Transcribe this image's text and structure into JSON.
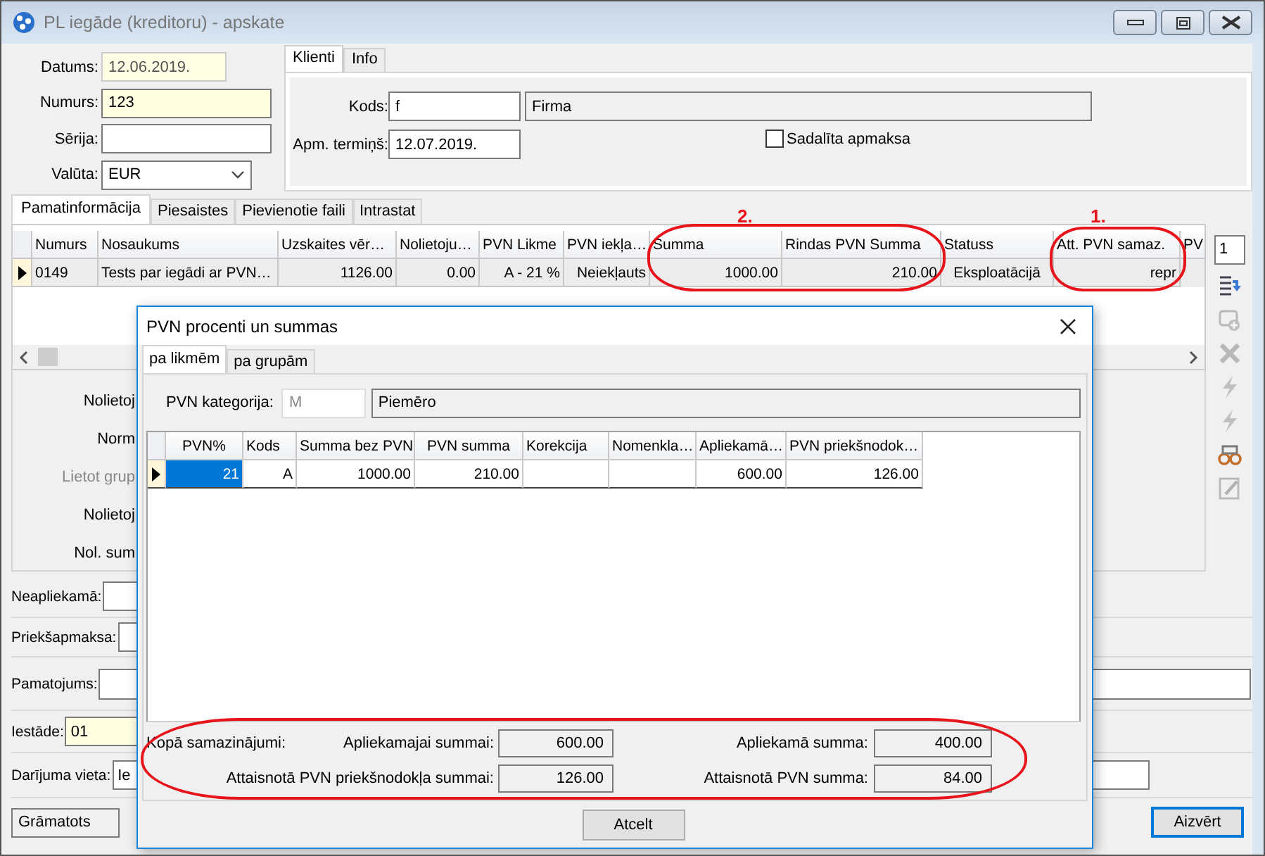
{
  "window": {
    "title": "PL iegāde (kreditoru) - apskate"
  },
  "header_fields": [
    {
      "label": "Datums:",
      "value": "12.06.2019.",
      "kind": "readonly"
    },
    {
      "label": "Numurs:",
      "value": "123",
      "kind": "required"
    },
    {
      "label": "Sērija:",
      "kind": "text"
    },
    {
      "label": "Valūta:",
      "value": "EUR",
      "kind": "dropdown"
    }
  ],
  "client_tabs": [
    {
      "label": "Klienti",
      "selected": true
    },
    {
      "label": "Info",
      "selected": false
    }
  ],
  "client": {
    "code_label": "Kods:",
    "code": "f",
    "name": "Firma",
    "due_label": "Apm. termiņš:",
    "due": "12.07.2019.",
    "split_payment": {
      "label": "Sadalīta apmaksa",
      "checked": false
    }
  },
  "main_tabs": [
    {
      "label": "Pamatinformācija",
      "selected": true
    },
    {
      "label": "Piesaistes",
      "selected": false
    },
    {
      "label": "Pievienotie faili",
      "selected": false
    },
    {
      "label": "Intrastat",
      "selected": false
    }
  ],
  "assets_table": {
    "columns": [
      "Numurs",
      "Nosaukums",
      "Uzskaites vēr…",
      "Nolietoju…",
      "PVN Likme",
      "PVN iekļa…",
      "Summa",
      "Rindas PVN Summa",
      "Statuss",
      "Att. PVN samaz.",
      "PV"
    ],
    "rows": [
      {
        "selected": true,
        "cells": [
          "0149",
          "Tests par iegādi ar PVN…",
          "1126.00",
          "0.00",
          "A - 21 %",
          "Neiekļauts",
          "1000.00",
          "210.00",
          "Eksploatācijā",
          "repr"
        ]
      }
    ]
  },
  "toolbar": {
    "page": "1",
    "buttons": [
      {
        "kind": "list",
        "disabled": false
      },
      {
        "kind": "add",
        "disabled": true
      },
      {
        "kind": "delete",
        "disabled": true
      },
      {
        "kind": "flash",
        "disabled": true
      },
      {
        "kind": "flash",
        "disabled": true
      },
      {
        "kind": "link",
        "disabled": false
      },
      {
        "kind": "edit",
        "disabled": true
      }
    ]
  },
  "details": [
    {
      "label": "Nolietoj",
      "disabled": false
    },
    {
      "label": "Norm",
      "disabled": false
    },
    {
      "label": "Lietot grup",
      "disabled": true
    },
    {
      "label": "Nolietoj",
      "disabled": false
    },
    {
      "label": "Nol. sum",
      "disabled": false
    }
  ],
  "bottom_fields": [
    {
      "label": "Neapliekamā:",
      "kind": "text"
    },
    {
      "label": "Priekšapmaksa:",
      "kind": "text"
    },
    {
      "label": "Pamatojums:",
      "kind": "memo"
    },
    {
      "label": "Iestāde:",
      "value": "01",
      "kind": "required"
    },
    {
      "label": "Darījuma vieta:",
      "value": "Ie",
      "kind": "text"
    }
  ],
  "status": "Grāmatots",
  "close_button": "Aizvērt",
  "dialog": {
    "title": "PVN procenti un summas",
    "tabs": [
      {
        "label": "pa likmēm",
        "selected": true
      },
      {
        "label": "pa grupām",
        "selected": false
      }
    ],
    "category_label": "PVN kategorija:",
    "category_code": "M",
    "category_name": "Piemēro",
    "table": {
      "columns": [
        "PVN%",
        "Kods",
        "Summa bez PVN",
        "PVN summa",
        "Korekcija",
        "Nomenkla…",
        "Apliekamā…",
        "PVN priekšnodok…"
      ],
      "rows": [
        {
          "selected": true,
          "cells": [
            "21",
            "A",
            "1000.00",
            "210.00",
            null,
            null,
            "600.00",
            "126.00"
          ]
        }
      ]
    },
    "totals": {
      "label": "Kopā samazinājumi:",
      "items": [
        {
          "label": "Apliekamajai summai:",
          "value": "600.00"
        },
        {
          "label": "Apliekamā summa:",
          "value": "400.00"
        },
        {
          "label": "Attaisnotā PVN priekšnodokļa summai:",
          "value": "126.00"
        },
        {
          "label": "Attaisnotā PVN summa:",
          "value": "84.00"
        }
      ]
    },
    "cancel_button": "Atcelt"
  },
  "annotations": [
    {
      "text": "2."
    },
    {
      "text": "1."
    }
  ]
}
